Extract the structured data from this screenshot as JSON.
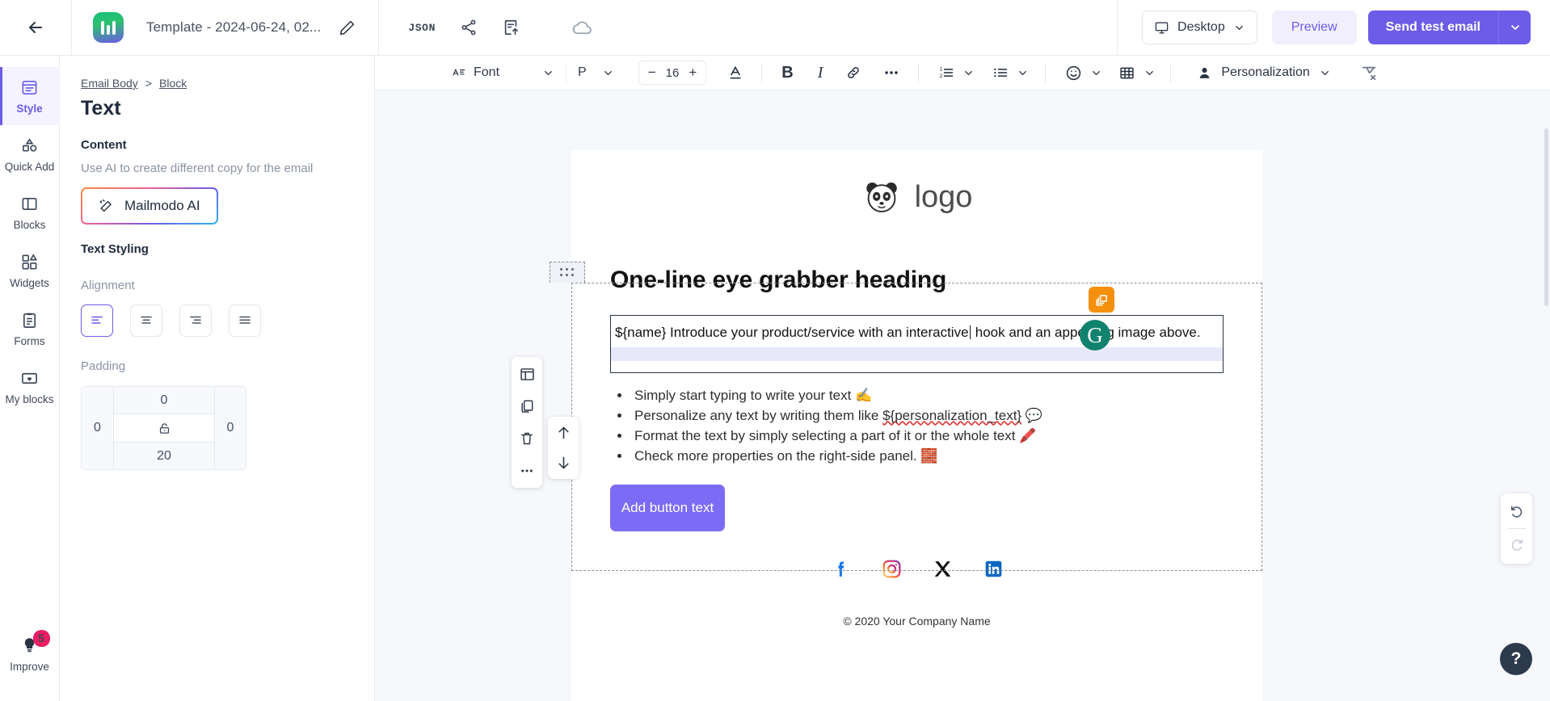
{
  "topbar": {
    "back_icon": "arrow-left-icon",
    "app_logo": "mailmodo-logo",
    "template_name": "Template - 2024-06-24, 02...",
    "edit_icon": "pencil-icon",
    "json_label": "JSON",
    "share_icon": "share-icon",
    "export_icon": "file-upload-icon",
    "save_cloud_icon": "cloud-icon",
    "device": {
      "label": "Desktop",
      "icon": "monitor-icon",
      "caret": "chevron-down-icon"
    },
    "preview_label": "Preview",
    "send_label": "Send test email",
    "send_caret": "chevron-down-icon"
  },
  "rail": {
    "items": [
      {
        "label": "Style",
        "icon": "style-icon",
        "active": true
      },
      {
        "label": "Quick Add",
        "icon": "quick-add-icon",
        "active": false
      },
      {
        "label": "Blocks",
        "icon": "blocks-icon",
        "active": false
      },
      {
        "label": "Widgets",
        "icon": "widgets-icon",
        "active": false
      },
      {
        "label": "Forms",
        "icon": "forms-icon",
        "active": false
      },
      {
        "label": "My blocks",
        "icon": "my-blocks-icon",
        "active": false
      }
    ],
    "improve": {
      "label": "Improve",
      "icon": "lightbulb-icon",
      "badge": "5"
    }
  },
  "panel": {
    "breadcrumb": {
      "root": "Email Body",
      "separator": ">",
      "current": "Block"
    },
    "title": "Text",
    "content_heading": "Content",
    "ai_hint": "Use AI to create different copy for the email",
    "ai_button": "Mailmodo AI",
    "ai_icon": "magic-wand-icon",
    "styling_heading": "Text Styling",
    "alignment_label": "Alignment",
    "alignment_options": [
      "align-left",
      "align-center",
      "align-right",
      "align-justify"
    ],
    "alignment_selected": "align-left",
    "padding_label": "Padding",
    "padding": {
      "left": "0",
      "top": "0",
      "right": "0",
      "bottom": "20",
      "lock_icon": "unlock-icon"
    }
  },
  "toolbar": {
    "font_label": "Font",
    "font_icon": "font-family-icon",
    "paragraph_label": "P",
    "font_size": "16",
    "decrease": "−",
    "increase": "+",
    "text_color_icon": "text-color-icon",
    "bold_label": "B",
    "italic_label": "I",
    "link_icon": "link-icon",
    "more_icon": "ellipsis-icon",
    "ordered_list_icon": "numbered-list-icon",
    "bullet_list_icon": "bullet-list-icon",
    "emoji_icon": "emoji-icon",
    "table_icon": "table-icon",
    "personalization_label": "Personalization",
    "personalization_icon": "user-icon",
    "clear_format_icon": "clear-formatting-icon"
  },
  "email": {
    "brand_text": "logo",
    "brand_icon": "panda-icon",
    "heading": "One-line eye grabber heading",
    "paragraph_before_caret": "${name} Introduce your product/service with an interactive",
    "paragraph_after_caret": " hook and an appealing image above.",
    "bullets": [
      {
        "text": "Simply start typing to write your text",
        "emoji": "✍️",
        "squiggle": ""
      },
      {
        "text": "Personalize any text by writing them like ",
        "squiggle": "${personalization_text}",
        "emoji": "💬"
      },
      {
        "text": "Format the text by simply selecting a part of it or the whole text",
        "emoji": "🖍️",
        "squiggle": ""
      },
      {
        "text": "Check more properties on the right-side panel.",
        "emoji": "🧱",
        "squiggle": ""
      }
    ],
    "cta_label": "Add button text",
    "socials": [
      "facebook-icon",
      "instagram-icon",
      "x-twitter-icon",
      "linkedin-icon"
    ],
    "copyright": "© 2020 Your Company Name"
  },
  "block_tools": {
    "items": [
      "layout-icon",
      "duplicate-icon",
      "delete-icon",
      "more-icon"
    ],
    "move": [
      "move-up-icon",
      "move-down-icon"
    ],
    "drag_handle": "drag-handle-icon"
  },
  "floating": {
    "orange_chip_icon": "layers-icon",
    "grammarly_icon": "G",
    "undo_icon": "undo-icon",
    "redo_icon": "redo-icon",
    "help_label": "?"
  },
  "colors": {
    "accent": "#6c5ce7",
    "cta": "#7c6cf5",
    "badge": "#e91e63",
    "highlight": "#f32020",
    "grammarly": "#11826d",
    "orange": "#f5900c"
  }
}
